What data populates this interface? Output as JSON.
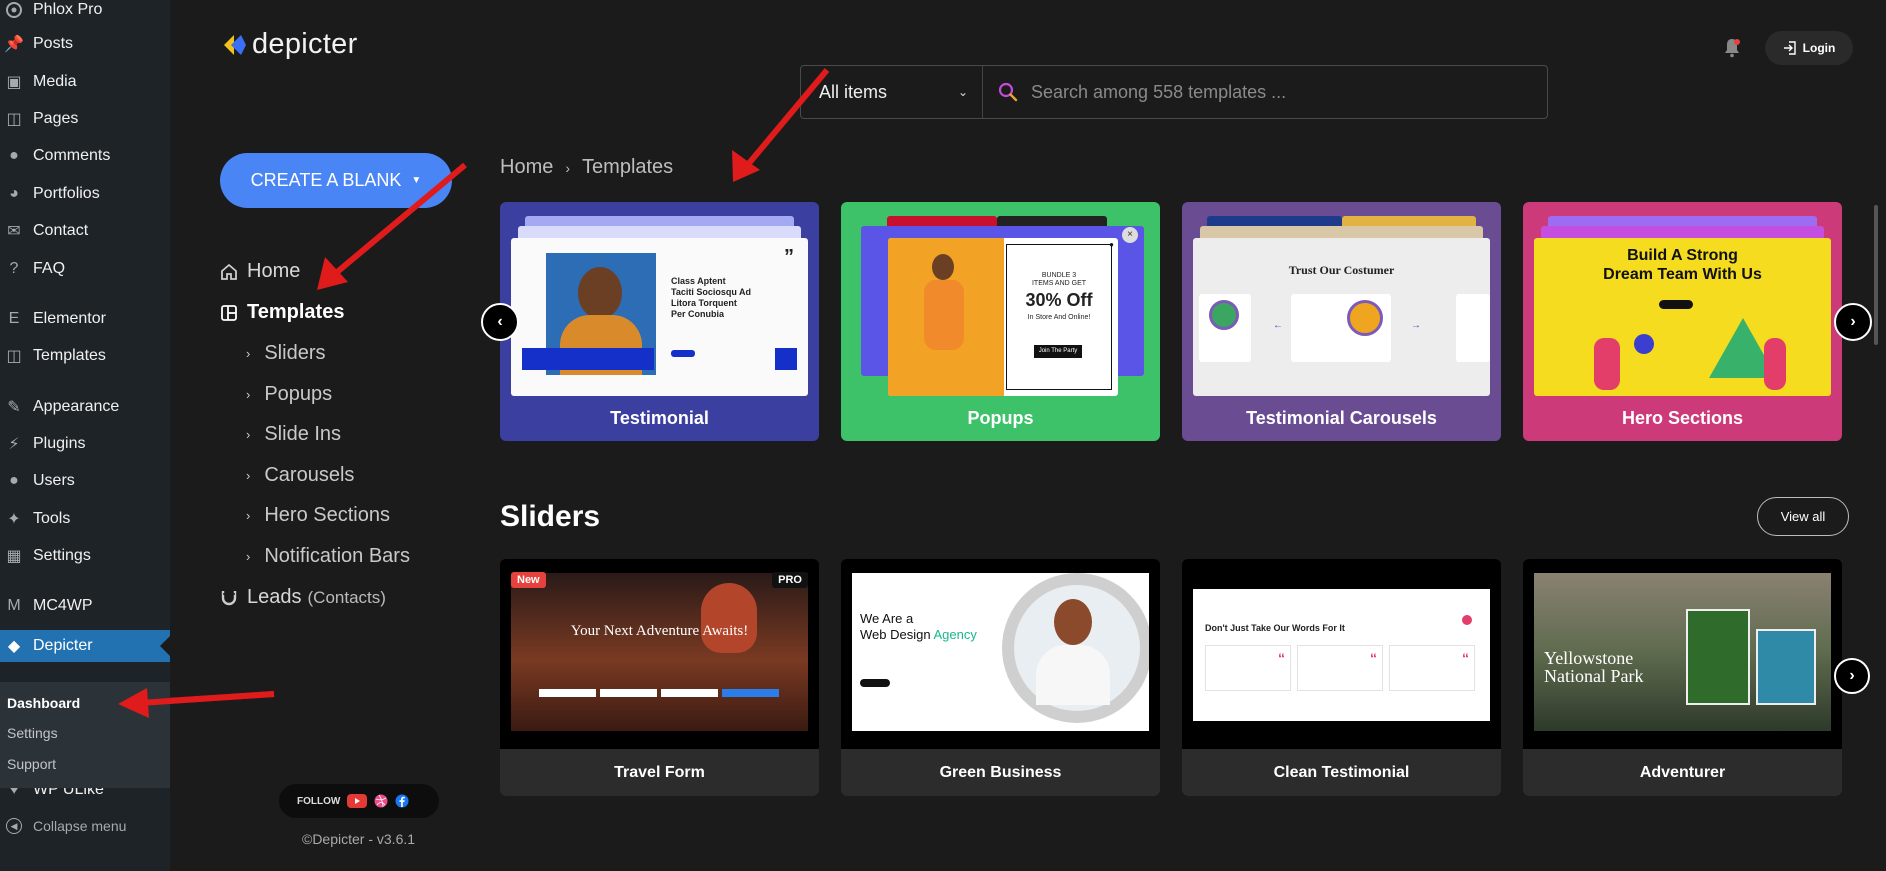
{
  "wp_menu": {
    "site": "Phlox Pro",
    "items": [
      {
        "label": "Posts",
        "icon": "pin-icon"
      },
      {
        "label": "Media",
        "icon": "media-icon"
      },
      {
        "label": "Pages",
        "icon": "pages-icon"
      },
      {
        "label": "Comments",
        "icon": "comment-icon"
      },
      {
        "label": "Portfolios",
        "icon": "portfolio-icon"
      },
      {
        "label": "Contact",
        "icon": "mail-icon"
      },
      {
        "label": "FAQ",
        "icon": "help-icon"
      },
      {
        "label": "Elementor",
        "icon": "elementor-icon"
      },
      {
        "label": "Templates",
        "icon": "folder-icon"
      },
      {
        "label": "Appearance",
        "icon": "brush-icon"
      },
      {
        "label": "Plugins",
        "icon": "plug-icon"
      },
      {
        "label": "Users",
        "icon": "user-icon"
      },
      {
        "label": "Tools",
        "icon": "wrench-icon"
      },
      {
        "label": "Settings",
        "icon": "settings-icon"
      },
      {
        "label": "MC4WP",
        "icon": "mc4wp-icon"
      },
      {
        "label": "Depicter",
        "icon": "depicter-icon"
      },
      {
        "label": "WP ULike",
        "icon": "heart-icon"
      },
      {
        "label": "Collapse menu",
        "icon": "collapse-icon"
      }
    ],
    "submenu": [
      "Dashboard",
      "Settings",
      "Support"
    ]
  },
  "header": {
    "brand": "depicter",
    "filter_label": "All items",
    "search_placeholder": "Search among 558 templates ...",
    "login_label": "Login"
  },
  "sidebar": {
    "create_label": "CREATE A BLANK",
    "home": "Home",
    "templates": "Templates",
    "sub": [
      "Sliders",
      "Popups",
      "Slide Ins",
      "Carousels",
      "Hero Sections",
      "Notification Bars"
    ],
    "leads": "Leads",
    "leads_sub": "(Contacts)",
    "follow": "FOLLOW",
    "copyright": "©Depicter - v3.6.1"
  },
  "breadcrumb": [
    "Home",
    "Templates"
  ],
  "categories": [
    {
      "title": "Testimonial",
      "color": "#3b3fa0"
    },
    {
      "title": "Popups",
      "color": "#3dc26a"
    },
    {
      "title": "Testimonial Carousels",
      "color": "#6a4c93"
    },
    {
      "title": "Hero Sections",
      "color": "#cc3a7a"
    }
  ],
  "cards_text": {
    "testimonial": {
      "lines": "Class Aptent\nTaciti Sociosqu Ad\nLitora Torquent\nPer Conubia"
    },
    "popup": {
      "l1": "BUNDLE 3",
      "l2": "ITEMS AND GET",
      "l3": "30% Off",
      "l4": "In Store And Online!",
      "btn": "Join The Party"
    },
    "carousel": {
      "title": "Trust Our Costumer"
    },
    "hero": {
      "title": "Build A Strong\nDream Team With Us"
    }
  },
  "sliders": {
    "title": "Sliders",
    "view_all": "View all",
    "items": [
      {
        "title": "Travel Form",
        "headline": "Your Next Adventure Awaits!",
        "badge_new": "New",
        "badge_pro": "PRO"
      },
      {
        "title": "Green Business",
        "headline": "We Are a\nWeb Design",
        "accent": "Agency"
      },
      {
        "title": "Clean Testimonial",
        "headline": "Don't Just Take Our Words For It"
      },
      {
        "title": "Adventurer",
        "headline": "Yellowstone\nNational Park"
      }
    ]
  }
}
